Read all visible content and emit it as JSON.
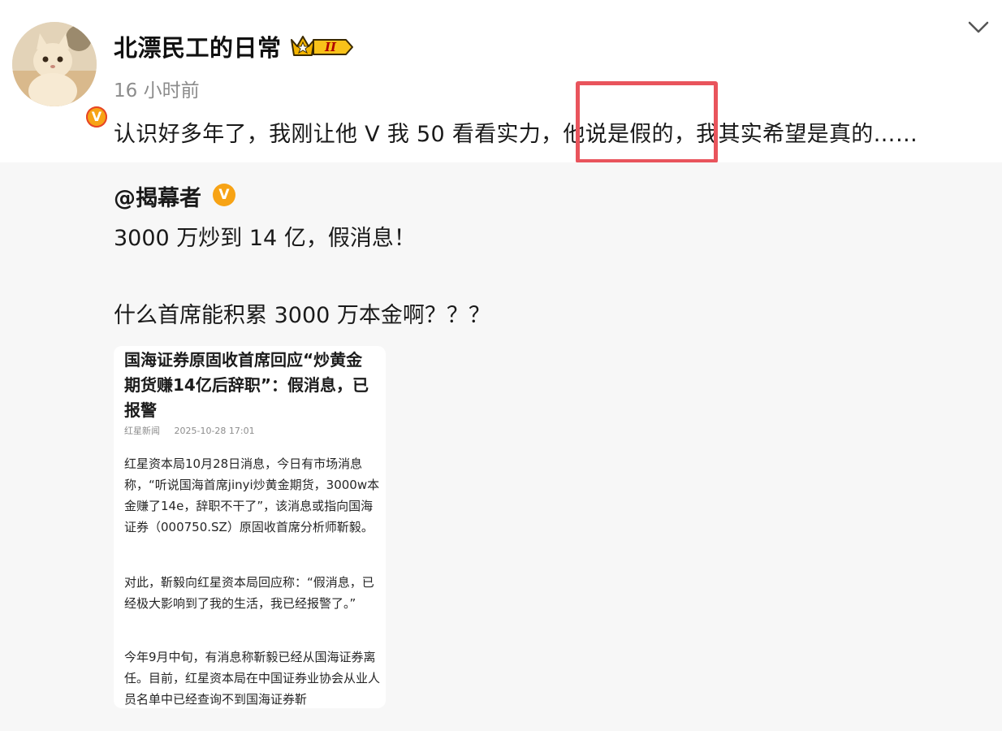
{
  "post": {
    "username": "北漂民工的日常",
    "vip_level": "II",
    "time": "16 小时前",
    "text": "认识好多年了，我刚让他 V 我 50 看看实力，他说是假的，我其实希望是真的……",
    "highlighted_phrase": "他说是假的，",
    "verify_mark": "V",
    "menu_icon": "chevron-down-icon"
  },
  "repost": {
    "author": "@揭幕者",
    "verify_mark": "V",
    "line1": "3000 万炒到 14 亿，假消息！",
    "line2": "什么首席能积累 3000 万本金啊？？？"
  },
  "article": {
    "title": "国海证券原固收首席回应“炒黄金期货赚14亿后辞职”：假消息，已报警",
    "source": "红星新闻",
    "date": "2025-10-28 17:01",
    "para1": "红星资本局10月28日消息，今日有市场消息称，“听说国海首席jinyi炒黄金期货，3000w本金赚了14e，辞职不干了”，该消息或指向国海证券（000750.SZ）原固收首席分析师靳毅。",
    "para2": "对此，靳毅向红星资本局回应称：“假消息，已经极大影响到了我的生活，我已经报警了。”",
    "para3": "今年9月中旬，有消息称靳毅已经从国海证券离任。目前，红星资本局在中国证券业协会从业人员名单中已经查询不到国海证券靳"
  },
  "colors": {
    "highlight_border": "#e9545c",
    "verify_orange": "#f7a315",
    "repost_bg": "#f7f7f7",
    "muted_text": "#8c8c8c"
  }
}
